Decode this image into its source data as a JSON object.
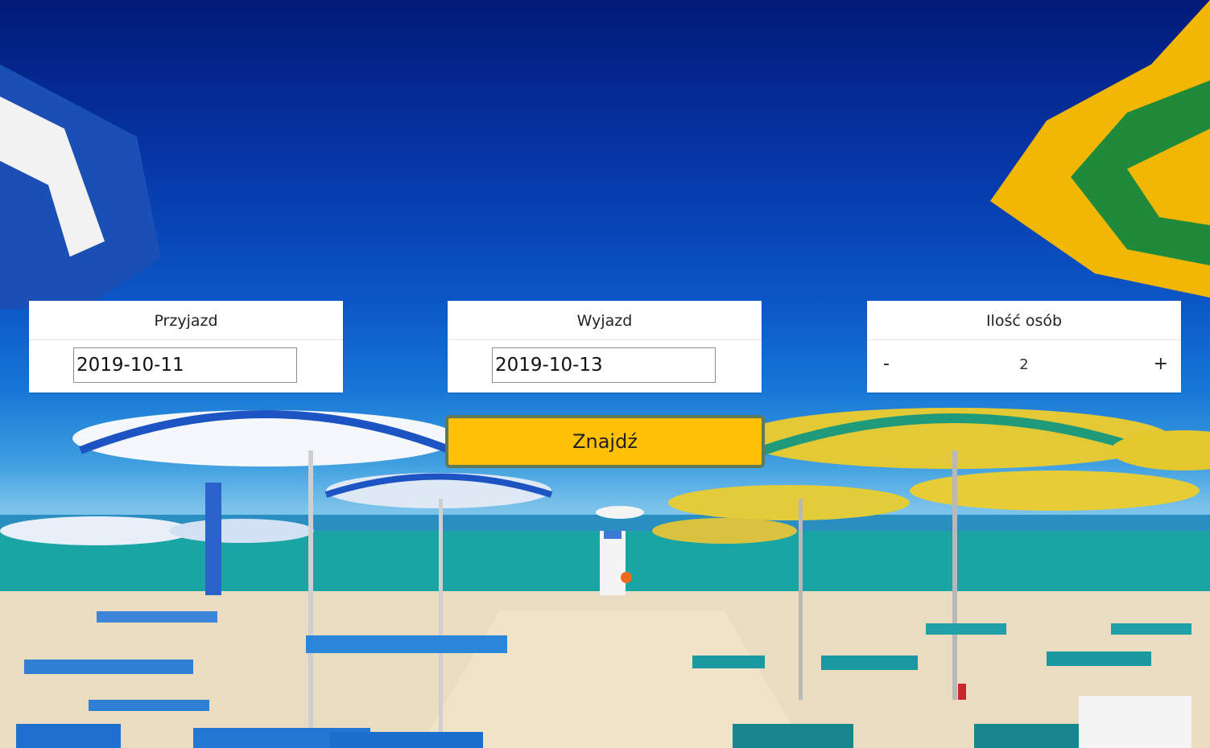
{
  "arrival": {
    "label": "Przyjazd",
    "value": "2019-10-11"
  },
  "departure": {
    "label": "Wyjazd",
    "value": "2019-10-13"
  },
  "guests": {
    "label": "Ilość osób",
    "decrement_label": "-",
    "value": "2",
    "increment_label": "+"
  },
  "search": {
    "label": "Znajdź"
  },
  "colors": {
    "accent": "#ffc107",
    "card": "#ffffff",
    "sky_top": "#021a78"
  }
}
